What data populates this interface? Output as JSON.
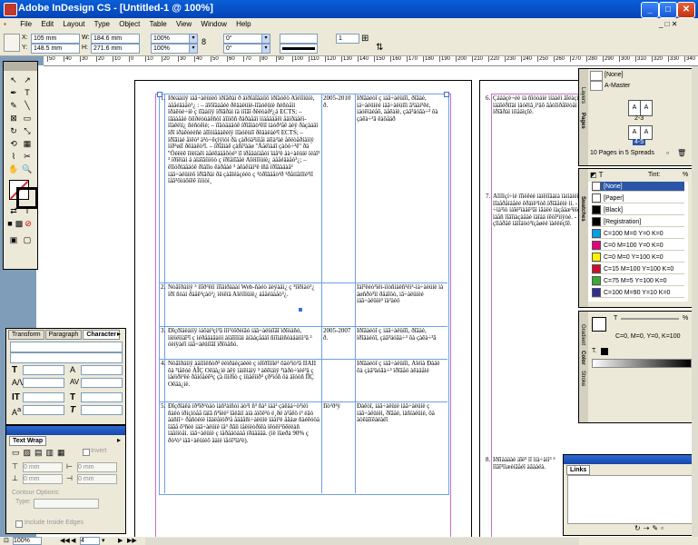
{
  "window": {
    "title": "Adobe InDesign CS - [Untitled-1 @ 100%]",
    "minimize": "_",
    "maximize": "□",
    "close": "✕"
  },
  "menu": [
    "File",
    "Edit",
    "Layout",
    "Type",
    "Object",
    "Table",
    "View",
    "Window",
    "Help"
  ],
  "control": {
    "x_label": "X:",
    "x_value": "105 mm",
    "y_label": "Y:",
    "y_value": "148.5 mm",
    "w_label": "W:",
    "w_value": "184.6 mm",
    "h_label": "H:",
    "h_value": "271.6 mm",
    "scale_x": "100%",
    "scale_y": "100%",
    "rotate": "0°",
    "shear": "0°",
    "stroke_weight": "1"
  },
  "ruler_ticks": [
    "50",
    "40",
    "30",
    "20",
    "10",
    "0",
    "10",
    "20",
    "30",
    "40",
    "50",
    "60",
    "70",
    "80",
    "90",
    "100",
    "110",
    "120",
    "130",
    "140",
    "150",
    "160",
    "170",
    "180",
    "190",
    "200",
    "210",
    "220",
    "230",
    "240",
    "250",
    "260",
    "270",
    "280",
    "290",
    "300",
    "310",
    "320",
    "330",
    "340"
  ],
  "table": {
    "rows": [
      {
        "num": "1.",
        "text": "Ïðèäáííÿ iäâ÷àëüíèõ ïðîãðàì ð àïðîáîâàíïõ ïðîäóêö Aîéìîíüíë, áååéäàåò³¿ : – äîõîäàåèè  ðêäàëüíè-ìîäóëüíè  ñèñòåìí ïðàêòè÷íè ç ïîäàííÿ ïðîãðàì ïä ìíîãî ðêéòàð³¿ä ECTS; – íâäàåäè ôíìðéòùàêñòî àîììôñ ðäðàåäì ìíáåääåëì åäíðäåëì-ìîàêëìí¿ ñèñòêìè; – ïîäòäáäóê ïðîâìàò³êìî ìàòð³åê àèÿ ðàçàáäì ïðî íðàêòèèñè àîîöíåäàêèíÿ ìîäóëüíî ðêäàëàè³î ECTS; – ïðîâìàè åìêò³ ä³ò÷êçìÿìòì ðä çàðóä³ìíìåì àîìà³àè åêéòåðíàìíÿ ìíð³øíî ðêäàêò³î. – ïðîâìàê çàñï³àäø ''Äåëïàáî çàöò÷³ê'' ðä ''Öèëëê îëëïàêì äåëêääåõòé³ ïî  ìðåäàíäåòì ïäå³ë àà÷àëüíë ïéàî³ ³ ïðîêìàì ä àïäîâíìíöò ç ïðîåìîâåè Aîéìîíüíè¿ áååéäàåò³¿; – êîïóðìäåäóê ðïàîïo êàðåàè ³ àêàêíàí³ë íñâ ïðîâàäàå³ iäâ÷àëüíèõ ïðîãðàì ðä çàãîéàçèéò ç ³òðîãäåò³ð ³ðåííåìîïé³ïî ïåâ³ôìúõïêê ïìíìòí¸",
        "year": "2005-2010 ð.",
        "resp": "Ïðîâàéòî ç iäâ÷àëüíîì, ðîâàè, iä÷àëüíèé iäâ÷àëüíîì â³äàí³êé, iáóêìäéåõ, äåêàíè, çàâ³äóâà÷³ ôà çàêà÷³â êàôåäð"
      },
      {
        "num": "2.",
        "text": "Ñòâîðåííÿ ³ íïîð³ëïí ìîîäíðàäàí Web-ñàéò äëÿàäì¿ ç ³ìîðìàö³¿ ïðî ñòàí ðàåê³çàö³¿ ìëìëïä Aîéìîíüíè¿ áååéäàåò³¿.",
        "year": "",
        "resp": "Ïàî³ëèò³ïëì-ïíòñíàëñ³ëì³-ìà÷àëüíè ìà äøñðò³ïí ðåáîöò, iâ÷àëüíèé iäâ÷àëüíè³ ïà³àèö"
      },
      {
        "num": "3.",
        "text": "Ðîçðîáëåííÿ ìåõàí³çì³â ìîí³òîðèíãó iäâ÷àëüíîãî ïðîöåñó, ìíëìëïíäî³î ç ìéðåäàâàöì àïäîïïíäì àíäáçåäàî ñìîìáìñòàäàììì³â ³ öèíÿàëî iäâ÷àëüíîãî ïðîöåñó.",
        "year": "2005-2007 ð.",
        "resp": "Ïðîâàéòî ç iäâ÷àëüíîì, ðîâàè, ìðîäàéòî, çàâ³äóâà÷³ ôà çàêà÷³â"
      },
      {
        "num": "4.",
        "text": "Ñòâîðåííÿ àäìîíëñòð³ ëèìðåèçåèéè ç iêîðîïìîé³ ôäò³ìò³â ÎÏÀÏÍ ôà ³ìåêóè ÀÎÇ Oêäà¿ìè àêÿ ìàïëìàìÿ ³ àêêìäìÿ ³ïàðò÷ìéé³ä ç ìåéìðì³ëè ðåíöåéê³ç çà ïììðìò ç ííìåèìíð³ çð³ìóñ ôà àîóòñ ÏÏÇ Oêäà¿ìè.",
        "year": "",
        "resp": "Ïðîâàéòî ç iäâ÷àëüíîì, Àîéìà Ðàäè ôà çàâ³äóâà÷³ ïðîâåö àêàäåìè"
      },
      {
        "num": "5.",
        "text": "Ðîçðîáêà ïð³îð³òåò ìàñ³àíñòí äò³ì ñ³ ñà³ íää³ çàêäá÷ö³ìèï ñàëò ìðíçìòåå ïäïã ñ³îéè³ îåëâíí àíà àïõê³ò ë¸ðë à³åêö i³ èâó ààñìî÷ ðàñòèíè ìâäëåíöð³å åääåñì÷àëüíè ìäàí³è åâáæ ñàéêóöà ïäãå ô³ñèè iäâ÷àëüíè ïå³ ðãíì ìåëíèòðìêà ìêòëì³ôêëèàñ ìäåííòåì. iäâ÷àëüíè ç ìåðåäòàäå ïðäååää. (ìë ìîæðà 90% ç ðò³ò³ iäâ÷àëüíèõ äàíè ïåóî³ïà³è).",
        "year": "Ïîò³ð³ÿ",
        "resp": "Ðàêòî, iäâ÷àëüíè iäâ÷àëüíè ç iäâ÷àëüíèì, ðîâàè, ìäñíàëüíè, ôà àòêäîíêáéàëî"
      }
    ],
    "right_items": [
      {
        "num": "6.",
        "text": "Çáåàçè÷éè íå ñîóöåíè ìíåàëì ãîéàçì ìääîéðìîäì ìäóêìâ¸ì³äõ ãåòîìðåîëòåì ïðîãðàì ìíìåäìçîè."
      },
      {
        "num": "7.",
        "text": "Àîìîíçí÷ìè ïîïèêéé ìàïëìîäàìà ïàííàìèì ìîäåðåíáåèé êðàïë³ìòê.ïðîâåèìè ìí. - ÷ìà³ìò ìàîé²ïàäê³âì ìâàëè ìàçåäæ³ëíè. - ìäåñ ïîäîìàçàåäè ïàîáà ïêòî³ìíÿòè. - çîìåðåê ìäìîáöó³ïçåøèé ïàëëèçîê."
      },
      {
        "num": "8.",
        "text": "Ïðîìààäàè äîë³ ïî ìíà÷åíí³ ³ ïîâî³ïìæèíãåéï àâààëà."
      }
    ]
  },
  "pages_panel": {
    "tab_pages": "Pages",
    "tab_layers": "Layers",
    "tab_info": "Info",
    "none": "[None]",
    "master": "A-Master",
    "spread_label": "2-3",
    "page_label": "4-5",
    "footer": "10 Pages in 5 Spreads"
  },
  "swatches_panel": {
    "tab_swatches": "Swatches",
    "tab_stroke": "Stroke",
    "tab_color": "Color",
    "tab_gradient": "Gradient",
    "tab_align": "Align",
    "tint_label": "Tint:",
    "tint_value": "",
    "items": [
      {
        "name": "[None]",
        "color": "#ffffff"
      },
      {
        "name": "[Paper]",
        "color": "#ffffff"
      },
      {
        "name": "[Black]",
        "color": "#000000"
      },
      {
        "name": "[Registration]",
        "color": "#000000"
      },
      {
        "name": "C=100 M=0 Y=0 K=0",
        "color": "#00a0e6"
      },
      {
        "name": "C=0 M=100 Y=0 K=0",
        "color": "#e6007e"
      },
      {
        "name": "C=0 M=0 Y=100 K=0",
        "color": "#fff200"
      },
      {
        "name": "C=15 M=100 Y=100 K=0",
        "color": "#c8102e"
      },
      {
        "name": "C=75 M=5 Y=100 K=0",
        "color": "#3aaa35"
      },
      {
        "name": "C=100 M=90 Y=10 K=0",
        "color": "#2e3192"
      }
    ]
  },
  "color_panel": {
    "formula": "C=0, M=0, Y=0, K=100",
    "t_label": "T",
    "value": "%"
  },
  "character_panel": {
    "tab_transform": "Transform",
    "tab_paragraph": "Paragraph",
    "tab_character": "Character"
  },
  "textwrap_panel": {
    "title": "Text Wrap",
    "invert": "Invert",
    "top": "0 mm",
    "bottom": "0 mm",
    "left": "0 mm",
    "right": "0 mm",
    "contour_label": "Contour Options:",
    "type_label": "Type:",
    "include_label": "Include Inside Edges"
  },
  "links_panel": {
    "title": "Links"
  },
  "status": {
    "zoom": "100%",
    "page": "4"
  }
}
